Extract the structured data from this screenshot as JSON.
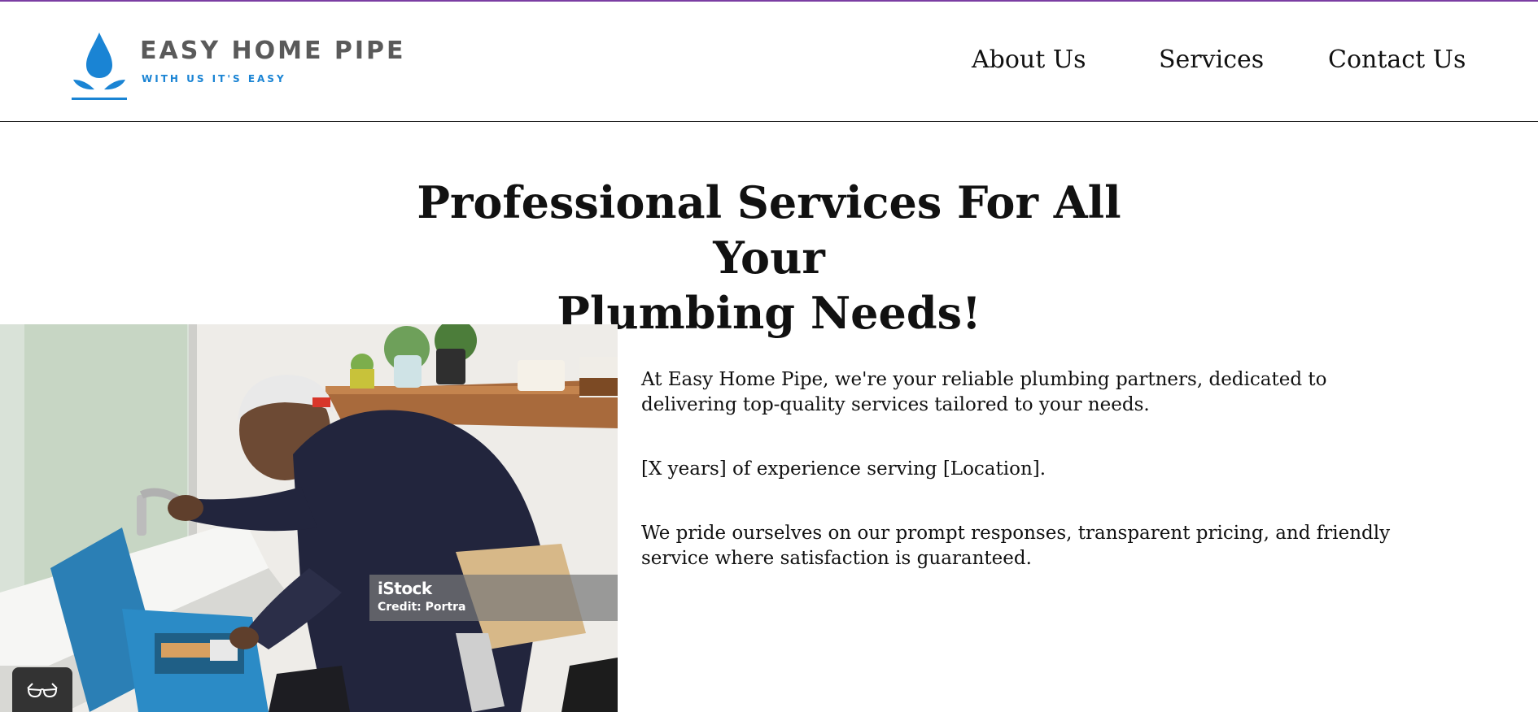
{
  "brand": {
    "name": "EASY HOME PIPE",
    "tagline": "WITH US IT'S EASY",
    "logo_icon": "water-drop-icon",
    "accent_color": "#1a84d4"
  },
  "nav": {
    "items": [
      {
        "label": "About Us"
      },
      {
        "label": "Services"
      },
      {
        "label": "Contact Us"
      }
    ]
  },
  "hero": {
    "title_line1": "Professional Services For All Your",
    "title_line2": "Plumbing Needs!"
  },
  "image": {
    "credit_brand": "iStock",
    "credit_text": "Credit: Portra"
  },
  "content": {
    "paragraphs": [
      "At Easy Home Pipe, we're your reliable plumbing partners, dedicated to delivering top-quality services tailored to your needs.",
      "[X years] of experience serving [Location].",
      "We pride ourselves on our prompt responses, transparent pricing, and friendly service where satisfaction is guaranteed."
    ]
  },
  "accessibility": {
    "icon": "glasses-icon"
  }
}
